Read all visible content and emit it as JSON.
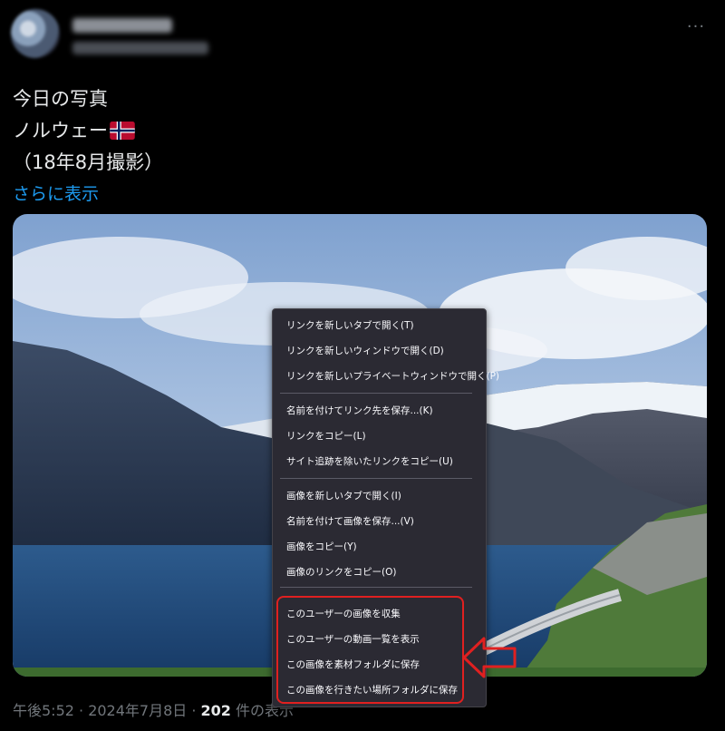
{
  "tweet": {
    "text_lines": [
      "今日の写真",
      "ノルウェー",
      "（18年8月撮影）"
    ],
    "show_more": "さらに表示",
    "more_menu": "···",
    "timestamp": "午後5:52 · 2024年7月8日 · ",
    "views_count": "202",
    "views_label": " 件の表示"
  },
  "context_menu": {
    "items": [
      "リンクを新しいタブで開く(T)",
      "リンクを新しいウィンドウで開く(D)",
      "リンクを新しいプライベートウィンドウで開く(P)",
      "名前を付けてリンク先を保存...(K)",
      "リンクをコピー(L)",
      "サイト追跡を除いたリンクをコピー(U)",
      "画像を新しいタブで開く(I)",
      "名前を付けて画像を保存...(V)",
      "画像をコピー(Y)",
      "画像のリンクをコピー(O)",
      "このユーザーの画像を収集",
      "このユーザーの動画一覧を表示",
      "この画像を素材フォルダに保存",
      "この画像を行きたい場所フォルダに保存"
    ]
  },
  "colors": {
    "background": "#000000",
    "link": "#1d9bf0",
    "menu_bg": "#2b2a33",
    "highlight": "#e02020"
  }
}
